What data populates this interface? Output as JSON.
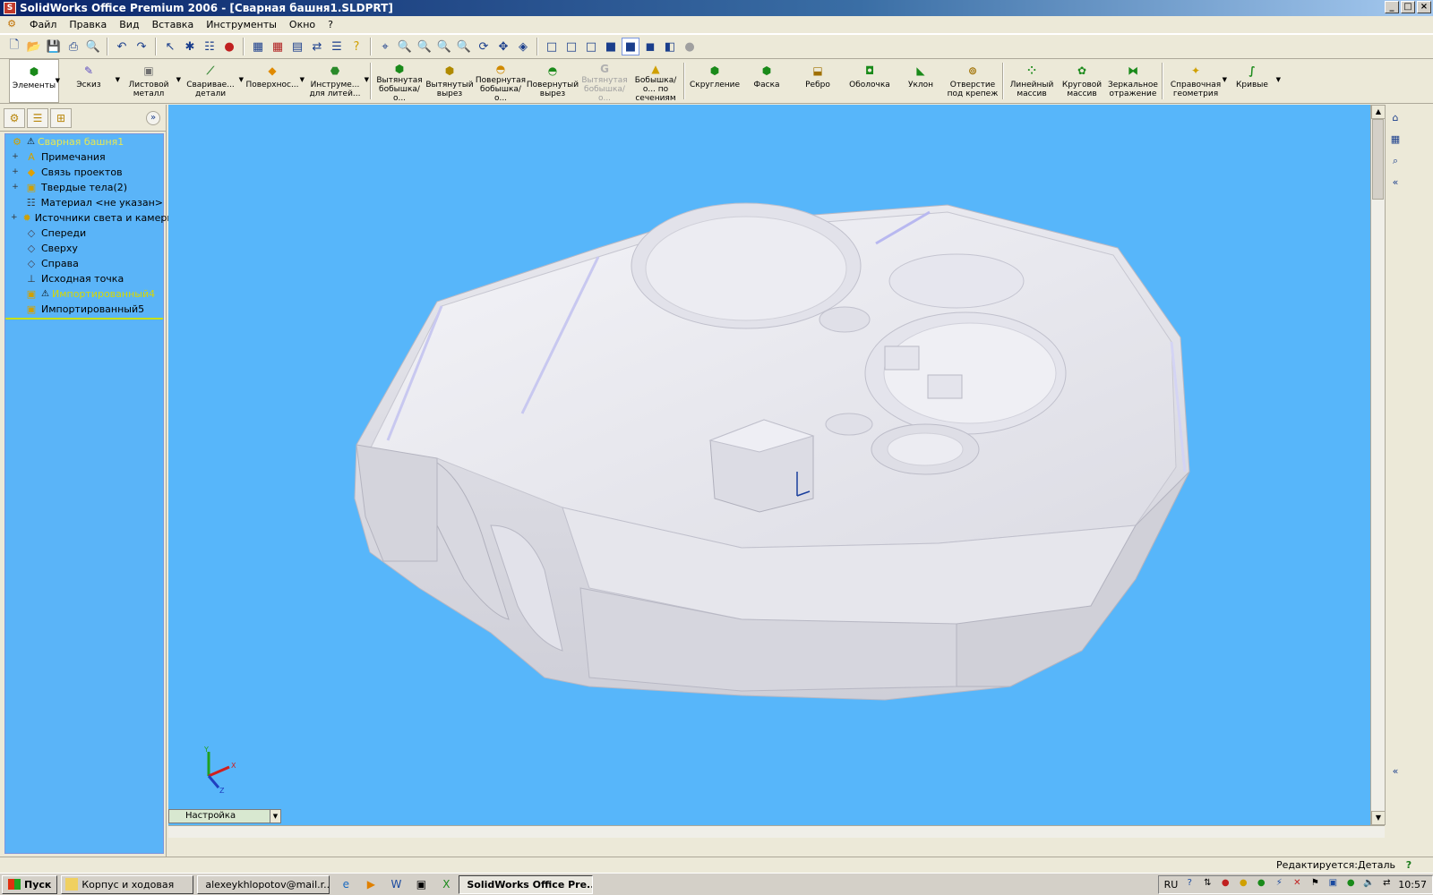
{
  "window": {
    "title": "SolidWorks Office Premium 2006 - [Сварная башня1.SLDPRT]"
  },
  "menu": [
    "Файл",
    "Правка",
    "Вид",
    "Вставка",
    "Инструменты",
    "Окно",
    "?"
  ],
  "features_toolbar": [
    {
      "label": "Элементы",
      "icon": "features-icon",
      "active": true,
      "dropdown": true
    },
    {
      "label": "Эскиз",
      "icon": "sketch-icon",
      "dropdown": true
    },
    {
      "label": "Листовой металл",
      "icon": "sheet-metal-icon",
      "dropdown": true
    },
    {
      "label": "Свариваe... детали",
      "icon": "weldments-icon",
      "dropdown": true
    },
    {
      "label": "Поверхнос...",
      "icon": "surfaces-icon",
      "dropdown": true
    },
    {
      "label": "Инструме... для литей...",
      "icon": "mold-tools-icon",
      "dropdown": true
    },
    {
      "label": "Вытянутая бобышка/о...",
      "icon": "extruded-boss-icon"
    },
    {
      "label": "Вытянутый вырез",
      "icon": "extruded-cut-icon"
    },
    {
      "label": "Повернутая бобышка/о...",
      "icon": "revolved-boss-icon"
    },
    {
      "label": "Повернутый вырез",
      "icon": "revolved-cut-icon"
    },
    {
      "label": "Вытянутая бобышка/о...",
      "icon": "swept-boss-icon",
      "disabled": true
    },
    {
      "label": "Бобышка/о... по сечениям",
      "icon": "loft-icon"
    },
    {
      "label": "Скругление",
      "icon": "fillet-icon"
    },
    {
      "label": "Фаска",
      "icon": "chamfer-icon"
    },
    {
      "label": "Ребро",
      "icon": "rib-icon"
    },
    {
      "label": "Оболочка",
      "icon": "shell-icon"
    },
    {
      "label": "Уклон",
      "icon": "draft-icon"
    },
    {
      "label": "Отверстие под крепеж",
      "icon": "hole-wizard-icon"
    },
    {
      "label": "Линейный массив",
      "icon": "linear-pattern-icon"
    },
    {
      "label": "Круговой массив",
      "icon": "circular-pattern-icon"
    },
    {
      "label": "Зеркальное отражение",
      "icon": "mirror-icon"
    },
    {
      "label": "Справочная геометрия",
      "icon": "reference-geometry-icon",
      "dropdown": true
    },
    {
      "label": "Кривые",
      "icon": "curves-icon",
      "dropdown": true
    }
  ],
  "feature_tree": {
    "root": "Сварная башня1",
    "items": [
      {
        "label": "Примечания",
        "icon": "annotations-icon",
        "expandable": true
      },
      {
        "label": "Связь проектов",
        "icon": "design-binder-icon",
        "expandable": true
      },
      {
        "label": "Твердые тела(2)",
        "icon": "solid-bodies-icon",
        "expandable": true
      },
      {
        "label": "Материал <не указан>",
        "icon": "material-icon",
        "expandable": false
      },
      {
        "label": "Источники света и камеры",
        "icon": "lights-icon",
        "expandable": true
      },
      {
        "label": "Спереди",
        "icon": "plane-icon",
        "expandable": false
      },
      {
        "label": "Сверху",
        "icon": "plane-icon",
        "expandable": false
      },
      {
        "label": "Справа",
        "icon": "plane-icon",
        "expandable": false
      },
      {
        "label": "Исходная точка",
        "icon": "origin-icon",
        "expandable": false
      },
      {
        "label": "Импортированный4",
        "icon": "imported-body-icon",
        "warning": true
      },
      {
        "label": "Импортированный5",
        "icon": "imported-body-icon",
        "warning": false
      }
    ]
  },
  "config_tab": "Настройка",
  "status": "Редактируется:Деталь",
  "taskbar": {
    "start": "Пуск",
    "buttons": [
      {
        "label": "Корпус и ходовая",
        "icon": "folder-icon"
      },
      {
        "label": "alexeykhlopotov@mail.r...",
        "icon": "firefox-icon"
      },
      {
        "label": "SolidWorks Office Pre...",
        "icon": "solidworks-icon",
        "active": true
      }
    ],
    "lang": "RU",
    "clock": "10:57"
  },
  "colors": {
    "viewport_bg": "#57b6fa",
    "tree_bg": "#5ab4f8",
    "model": "#e6e6ee"
  }
}
